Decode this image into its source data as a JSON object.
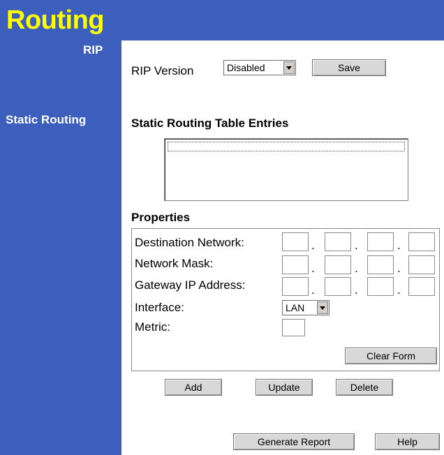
{
  "header": {
    "title": "Routing"
  },
  "sidebar": {
    "rip": "RIP",
    "static_routing": "Static Routing"
  },
  "rip": {
    "version_label": "RIP Version",
    "version_value": "Disabled",
    "save_label": "Save"
  },
  "static": {
    "table_heading": "Static Routing Table Entries",
    "properties_heading": "Properties",
    "dest_label": "Destination Network:",
    "mask_label": "Network Mask:",
    "gateway_label": "Gateway IP Address:",
    "interface_label": "Interface:",
    "interface_value": "LAN",
    "metric_label": "Metric:",
    "dot": ".",
    "clear_label": "Clear Form",
    "add_label": "Add",
    "update_label": "Update",
    "delete_label": "Delete"
  },
  "footer": {
    "report_label": "Generate Report",
    "help_label": "Help"
  }
}
